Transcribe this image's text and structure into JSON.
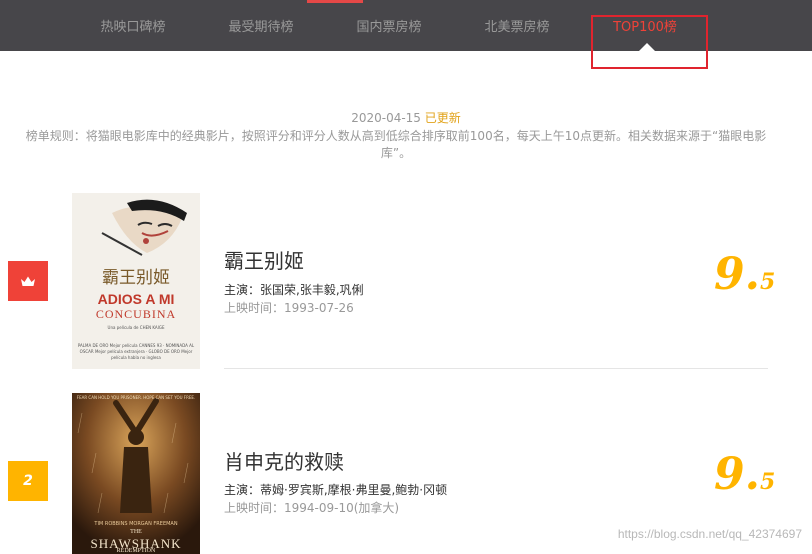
{
  "nav": {
    "items": [
      {
        "label": "热映口碑榜"
      },
      {
        "label": "最受期待榜"
      },
      {
        "label": "国内票房榜"
      },
      {
        "label": "北美票房榜"
      },
      {
        "label": "TOP100榜"
      }
    ],
    "active_color": "#ef4238",
    "background": "#47464a"
  },
  "board": {
    "date": "2020-04-15",
    "updated": "已更新",
    "rules": "榜单规则：将猫眼电影库中的经典影片，按照评分和评分人数从高到低综合排序取前100名，每天上午10点更新。相关数据来源于“猫眼电影库”。"
  },
  "movies": [
    {
      "rank_icon": "crown-icon",
      "title": "霸王别姬",
      "actors": "主演：张国荣,张丰毅,巩俐",
      "release": "上映时间：1993-07-26",
      "score_int": "9.",
      "score_frac": "5",
      "poster": {
        "calligraphy": "霸王别姬",
        "line1": "ADIOS A MI",
        "line2": "CONCUBINA",
        "caption": "Una película de CHEN KAIGE",
        "credits": "PALMA DE ORO Mejor película CANNES 93 · NOMINADA AL OSCAR Mejor película extranjera · GLOBO DE ORO Mejor película habla no inglesa"
      }
    },
    {
      "rank": "2",
      "title": "肖申克的救赎",
      "actors": "主演：蒂姆·罗宾斯,摩根·弗里曼,鲍勃·冈顿",
      "release": "上映时间：1994-09-10(加拿大)",
      "score_int": "9.",
      "score_frac": "5",
      "poster": {
        "tagline": "FEAR CAN HOLD YOU PRISONER. HOPE CAN SET YOU FREE.",
        "cast": "TIM ROBBINS   MORGAN FREEMAN",
        "title1": "THE",
        "title2": "SHAWSHANK",
        "title3": "REDEMPTION"
      }
    }
  ],
  "watermark": "https://blog.csdn.net/qq_42374697"
}
